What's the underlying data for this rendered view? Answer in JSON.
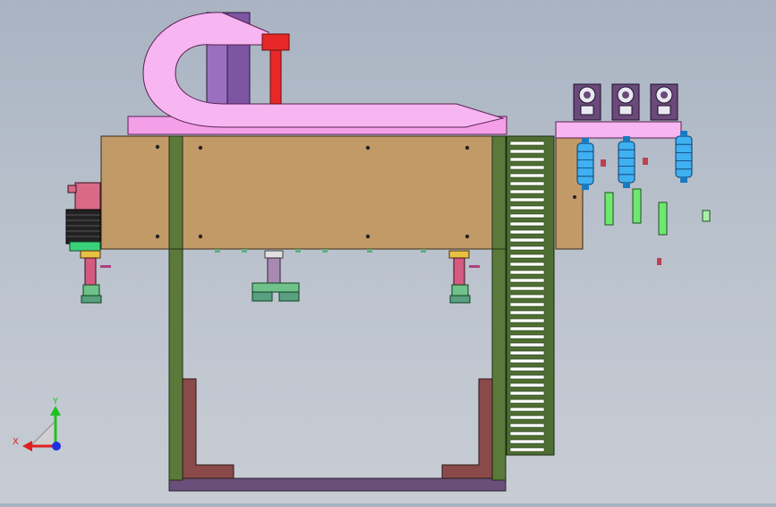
{
  "viewport": {
    "background_top": "#a9b3c2",
    "background_bottom": "#c8cdd4"
  },
  "triad": {
    "x_label": "X",
    "y_label": "Y",
    "x_color": "#e02020",
    "y_color": "#20c020",
    "z_color": "#2030e0"
  },
  "colors": {
    "frame_green": "#5b7a3a",
    "base_purple": "#6a4f7a",
    "tan_panel": "#c29a68",
    "pink_arm": "#f7b6f2",
    "red_rod": "#e82828",
    "violet_block": "#9a6fc0",
    "maroon_bracket": "#8a4a4a",
    "cyan_part": "#3fb0f0",
    "lime_part": "#6ee86e",
    "teal_foot": "#5aa080"
  }
}
